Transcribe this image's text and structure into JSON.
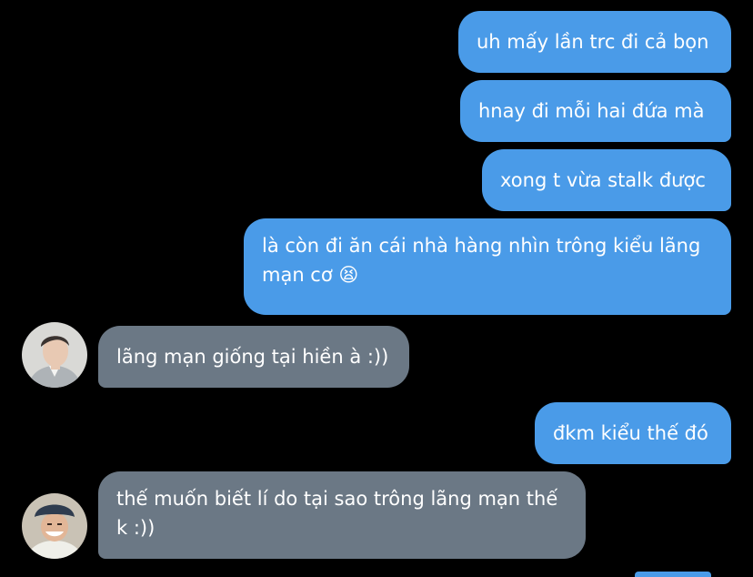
{
  "conversation": {
    "messages": [
      {
        "sender": "me",
        "text": "uh mấy lần trc đi cả bọn"
      },
      {
        "sender": "me",
        "text": "hnay đi mỗi hai đứa mà"
      },
      {
        "sender": "me",
        "text": "xong t vừa stalk được"
      },
      {
        "sender": "me",
        "text": "là còn đi ăn cái nhà hàng nhìn trông kiểu lãng mạn cơ 😫"
      },
      {
        "sender": "other",
        "text": "lãng mạn giống tại hiền à :))"
      },
      {
        "sender": "me",
        "text": "đkm kiểu thế đó"
      },
      {
        "sender": "other",
        "text": "thế muốn biết lí do tại sao trông lãng mạn thế k :))"
      }
    ]
  },
  "colors": {
    "background": "#000000",
    "outgoing_bubble": "#4a9be8",
    "incoming_bubble": "#6b7885",
    "text": "#ffffff"
  }
}
